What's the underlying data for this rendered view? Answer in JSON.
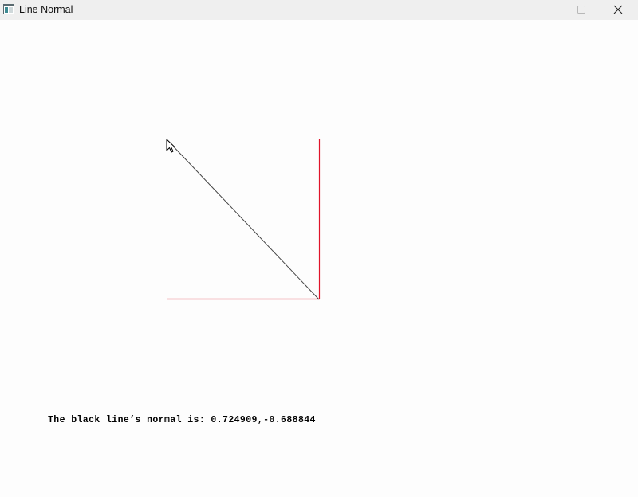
{
  "window": {
    "title": "Line Normal",
    "icon": "app-window-icon",
    "controls": {
      "minimize_icon": "minimize-icon",
      "maximize_icon": "maximize-icon",
      "close_icon": "close-icon"
    }
  },
  "scene": {
    "line_color": "#444444",
    "axis_color": "#e0142a",
    "background": "#fdfdfd"
  },
  "status": {
    "normal_text": "The black line’s normal is: 0.724909,-0.688844"
  },
  "cursor": {
    "icon": "mouse-pointer-icon"
  }
}
